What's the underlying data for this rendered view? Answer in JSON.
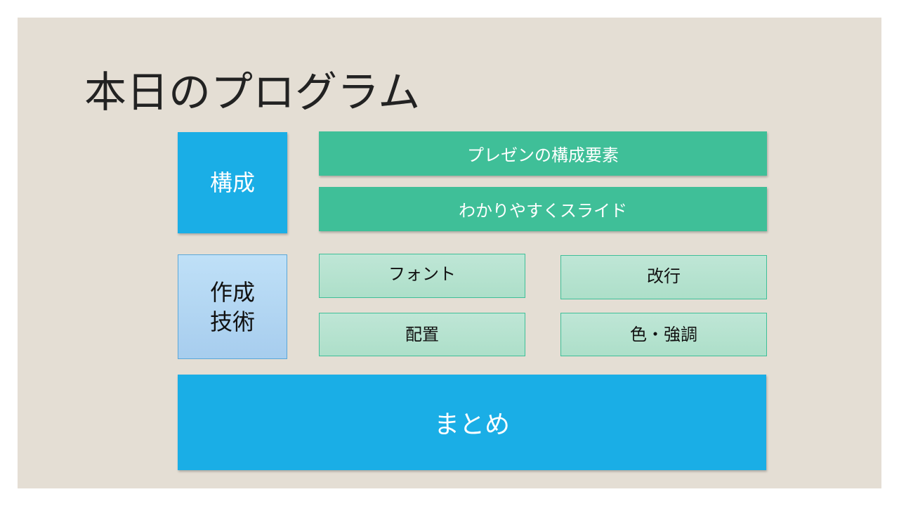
{
  "slide": {
    "title": "本日のプログラム",
    "sections": {
      "structure": {
        "label": "構成",
        "items": [
          "プレゼンの構成要素",
          "わかりやすくスライド"
        ]
      },
      "technique": {
        "label_lines": [
          "作成",
          "技術"
        ],
        "items": [
          "フォント",
          "改行",
          "配置",
          "色・強調"
        ]
      },
      "summary": {
        "label": "まとめ"
      }
    }
  },
  "colors": {
    "background": "#e4ded4",
    "blue": "#1aaee6",
    "light_blue": "#b3d6f2",
    "green": "#3fbf98",
    "mint": "#b6e2cf"
  }
}
